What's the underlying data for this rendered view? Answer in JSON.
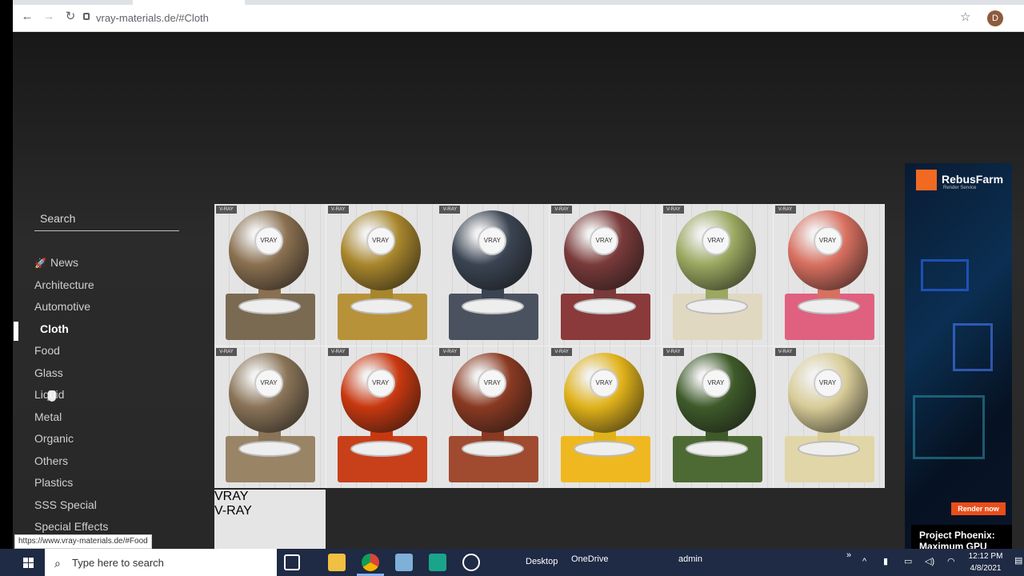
{
  "browser": {
    "url": "vray-materials.de/#Cloth",
    "profile_initial": "D",
    "icons": [
      "back-icon",
      "forward-icon",
      "reload-icon",
      "lock-icon",
      "star-icon"
    ]
  },
  "sidebar": {
    "search_placeholder": "Search",
    "items": [
      {
        "label": "News",
        "icon": "rocket-icon"
      },
      {
        "label": "Architecture"
      },
      {
        "label": "Automotive"
      },
      {
        "label": "Cloth",
        "active": true
      },
      {
        "label": "Food"
      },
      {
        "label": "Glass"
      },
      {
        "label": "Liquid"
      },
      {
        "label": "Metal"
      },
      {
        "label": "Organic"
      },
      {
        "label": "Others"
      },
      {
        "label": "Plastics"
      },
      {
        "label": "SSS Special"
      },
      {
        "label": "Special Effects"
      }
    ]
  },
  "materials": {
    "tile_logo": "V-RAY",
    "badge_text": "VRAY",
    "tiles": [
      {
        "color": "#8a7050",
        "floor": "#7a6a52"
      },
      {
        "color": "#a8862c",
        "floor": "#b89238"
      },
      {
        "color": "#3a4452",
        "floor": "#4a5260"
      },
      {
        "color": "#7a3a3a",
        "floor": "#8a3a3a"
      },
      {
        "color": "#9aa860",
        "floor": "#e0d8c0"
      },
      {
        "color": "#d87060",
        "floor": "#e06080"
      },
      {
        "color": "#8a7458",
        "floor": "#9a8466"
      },
      {
        "color": "#c83810",
        "floor": "#c8401a"
      },
      {
        "color": "#8a3a22",
        "floor": "#a04a30"
      },
      {
        "color": "#e0b21a",
        "floor": "#f0b820"
      },
      {
        "color": "#3e5a2a",
        "floor": "#4e6a34"
      },
      {
        "color": "#d8cc98",
        "floor": "#e0d6a8"
      },
      {
        "color": "#9a3a4a",
        "floor": "#b0485a"
      }
    ]
  },
  "ad": {
    "brand": "RebusFarm",
    "sub": "Render Service",
    "button": "Render now",
    "title": "Project Phoenix: Maximum GPU"
  },
  "status_url": "https://www.vray-materials.de/#Food",
  "taskbar": {
    "search_placeholder": "Type here to search",
    "desktop_label": "Desktop",
    "onedrive_label": "OneDrive",
    "admin_label": "admin",
    "time": "12:12 PM",
    "date": "4/8/2021"
  }
}
